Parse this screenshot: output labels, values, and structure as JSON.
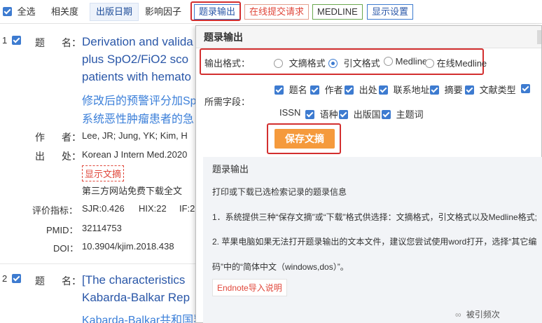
{
  "toolbar": {
    "select_all": "全选",
    "sort_relevance": "相关度",
    "sort_pubdate": "出版日期",
    "sort_impact": "影响因子",
    "export_btn": "题录输出",
    "online_request_btn": "在线提交请求",
    "medline_btn": "MEDLINE",
    "display_settings_btn": "显示设置"
  },
  "records": [
    {
      "num": "1",
      "title_label": "题",
      "title_label2": "名：",
      "title_en_1": "Derivation and valida",
      "title_en_2": "plus SpO2/FiO2 sco",
      "title_en_3": "patients with hemato",
      "title_cn_1": "修改后的预警评分加Sp",
      "title_cn_2": "系统恶性肿瘤患者的急",
      "author_label": "作",
      "author_label2": "者：",
      "authors": "Lee, JR; Jung, YK; Kim, H",
      "source_label": "出",
      "source_label2": "处：",
      "source": "Korean J Intern Med.2020",
      "show_abstract": "显示文摘",
      "free_download": "第三方网站免费下载全文",
      "metrics_label": "评价指标：",
      "sjr": "SJR:0.426",
      "hix": "HIX:22",
      "if_partial": "IF:2",
      "pmid_label": "PMID：",
      "pmid": "32114753",
      "doi_label": "DOI：",
      "doi": "10.3904/kjim.2018.438"
    },
    {
      "num": "2",
      "title_label": "题",
      "title_label2": "名：",
      "title_en_1": "[The characteristics",
      "title_en_2": "Kabarda-Balkar Rep",
      "title_cn_1": "Kabarda-Balkar共和国乳腺癌的发病特征。"
    }
  ],
  "dialog": {
    "title": "题录输出",
    "format_label": "输出格式：",
    "formats": [
      {
        "label": "文摘格式",
        "selected": false
      },
      {
        "label": "引文格式",
        "selected": true
      },
      {
        "label": "Medline",
        "selected": false
      },
      {
        "label": "在线Medline",
        "selected": false
      }
    ],
    "fields_label": "所需字段：",
    "fields_row1": [
      "题名",
      "作者",
      "出处",
      "联系地址",
      "摘要",
      "文献类型"
    ],
    "fields_row2": [
      "ISSN",
      "语种",
      "出版国",
      "主题词"
    ],
    "save_btn": "保存文摘",
    "info": {
      "heading": "题录输出",
      "line1": "打印或下载已选检索记录的题录信息",
      "line2": "1．系统提供三种“保存文摘”或“下载”格式供选择：文摘格式，引文格式以及Medline格式;",
      "line3": "2. 苹果电脑如果无法打开题录输出的文本文件，建议您尝试使用word打开，选择“其它编",
      "line4": "码”中的“简体中文（windows,dos）”。",
      "endnote_btn": "Endnote导入说明"
    }
  },
  "cite_freq": "被引频次",
  "colors": {
    "accent_blue": "#3d7bd0",
    "title_blue": "#2a57a8",
    "highlight_red": "#d32f2f",
    "save_orange": "#f59a3c"
  }
}
